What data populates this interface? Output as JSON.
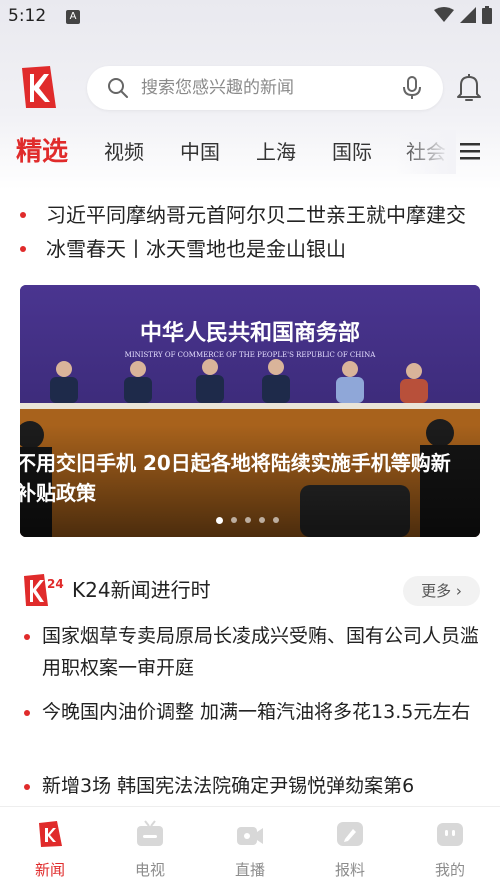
{
  "status_bar": {
    "time": "5:12",
    "notif_badge": "A"
  },
  "header": {
    "search_placeholder": "搜索您感兴趣的新闻",
    "icons": [
      "k-logo-icon",
      "search-icon",
      "microphone-icon",
      "bell-icon"
    ]
  },
  "tabs": [
    {
      "label": "精选",
      "active": true
    },
    {
      "label": "视频"
    },
    {
      "label": "中国"
    },
    {
      "label": "上海"
    },
    {
      "label": "国际"
    },
    {
      "label": "社会"
    }
  ],
  "headlines": [
    {
      "text": "习近平同摩纳哥元首阿尔贝二世亲王就中摩建交"
    },
    {
      "text": "冰雪春天丨冰天雪地也是金山银山"
    }
  ],
  "banner": {
    "title": "不用交旧手机 20日起各地将陆续实施手机等购新补贴政策",
    "backdrop_title": "中华人民共和国商务部",
    "backdrop_subtitle": "MINISTRY OF COMMERCE OF THE PEOPLE'S REPUBLIC OF CHINA",
    "slides": 5,
    "current_slide": 1
  },
  "k24": {
    "title": "K24新闻进行时",
    "more_label": "更多 ›",
    "items": [
      {
        "text": "国家烟草专卖局原局长凌成兴受贿、国有公司人员滥用职权案一审开庭"
      },
      {
        "text": "今晚国内油价调整 加满一箱汽油将多花13.5元左右"
      },
      {
        "text": "新增3场 韩国宪法法院确定尹锡悦弹劾案第6"
      }
    ]
  },
  "bottom_nav": [
    {
      "label": "新闻",
      "icon": "news-icon",
      "active": true
    },
    {
      "label": "电视",
      "icon": "tv-icon"
    },
    {
      "label": "直播",
      "icon": "live-camera-icon"
    },
    {
      "label": "报料",
      "icon": "report-icon"
    },
    {
      "label": "我的",
      "icon": "profile-icon"
    }
  ],
  "colors": {
    "accent": "#e02b2b",
    "banner_bg": "#3c2a7a"
  }
}
